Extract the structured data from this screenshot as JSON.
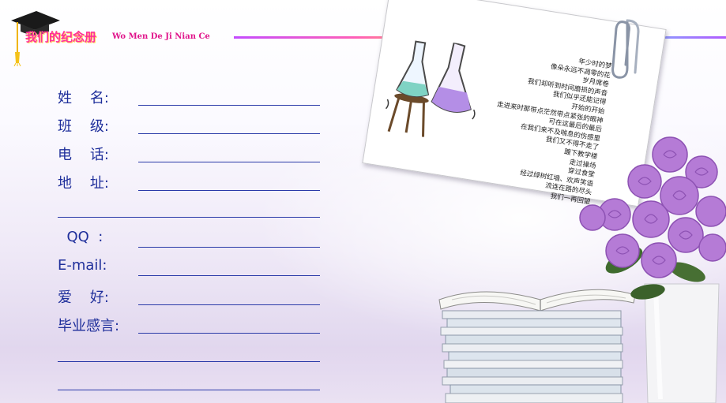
{
  "header": {
    "title": "我们的纪念册",
    "subtitle": "Wo Men De Ji Nian Ce"
  },
  "form": {
    "name_label": "姓    名:",
    "class_label": "班    级:",
    "phone_label": "电    话:",
    "address_label": "地    址:",
    "qq_label": "  QQ  :",
    "email_label": "E-mail:",
    "hobby_label": "爱    好:",
    "message_label": "毕业感言:"
  },
  "poem": {
    "lines": [
      "年少时的梦",
      "像朵永远不凋零的花",
      "岁月席卷",
      "我们却听到时间磨损的声音",
      "我们似乎还能记得",
      "开始的开始",
      "走进来时那带点茫然带点紧张的眼神",
      "可在这最后的最后",
      "在我们来不及喘息的伤感里",
      "我们又不得不走了",
      "踱下教学楼",
      "走过操场",
      "穿过食堂",
      "经过绿树红墙、欢声笑语",
      "流连在路的尽头",
      "我们一再回望"
    ]
  },
  "icons": {
    "cap": "graduation-cap-icon",
    "flasks": "flasks-icon",
    "clip": "paperclip-icon",
    "books": "book-stack-icon",
    "flowers": "rose-vase-icon"
  },
  "colors": {
    "label": "#1f2f9b",
    "title": "#ff2f9a",
    "roses": "#b57bd6"
  }
}
